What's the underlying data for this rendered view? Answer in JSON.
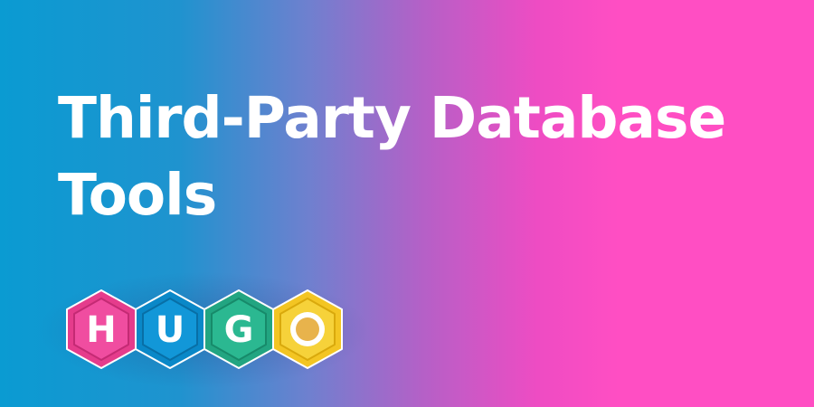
{
  "headline": {
    "line1": "Third-Party Database",
    "line2": "Tools"
  },
  "logo": {
    "letters": [
      {
        "char": "H",
        "outer": "#e53c8c",
        "inner": "#f04da0",
        "stroke": "#c42a74"
      },
      {
        "char": "U",
        "outer": "#0a88c8",
        "inner": "#1297d8",
        "stroke": "#086fa6"
      },
      {
        "char": "G",
        "outer": "#22a581",
        "inner": "#2bb891",
        "stroke": "#178a6a"
      },
      {
        "char": "",
        "outer": "#f3c523",
        "inner": "#f6d23a",
        "stroke": "#d9a90c",
        "ring": "#e8b34c"
      }
    ]
  },
  "colors": {
    "gradient_start": "#0a9bd2",
    "gradient_mid": "#b560c7",
    "gradient_end": "#ff4ec3",
    "text": "#ffffff"
  }
}
